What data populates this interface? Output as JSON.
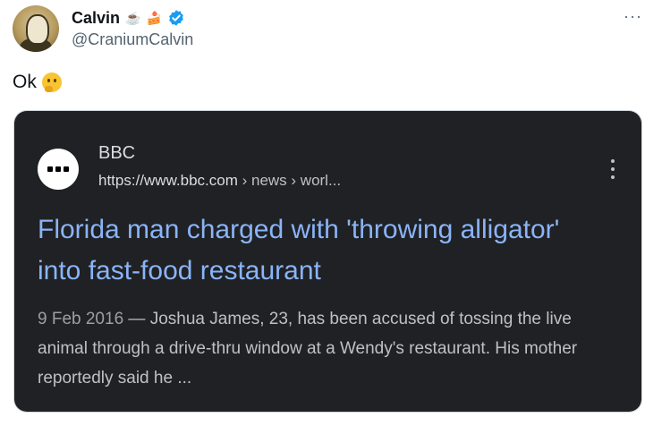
{
  "tweet": {
    "display_name": "Calvin",
    "name_emojis": "☕",
    "name_emojis_extra": "🍰",
    "handle": "@CraniumCalvin",
    "text": "Ok",
    "text_emoji": "thinking-face",
    "verified": true,
    "more_icon": "more-horizontal-icon"
  },
  "card": {
    "site_name": "BBC",
    "url_host": "https://www.bbc.com",
    "url_path": " › news › worl...",
    "title": "Florida man charged with 'throwing alligator' into fast-food restaurant",
    "date": "9 Feb 2016",
    "snippet": "Joshua James, 23, has been accused of tossing the live animal through a drive-thru window at a Wendy's restaurant. His mother reportedly said he ...",
    "date_separator": " — ",
    "menu_icon": "more-vertical-icon"
  },
  "colors": {
    "card_background": "#202124",
    "title_link": "#8ab4f8",
    "verified_blue": "#1d9bf0"
  }
}
